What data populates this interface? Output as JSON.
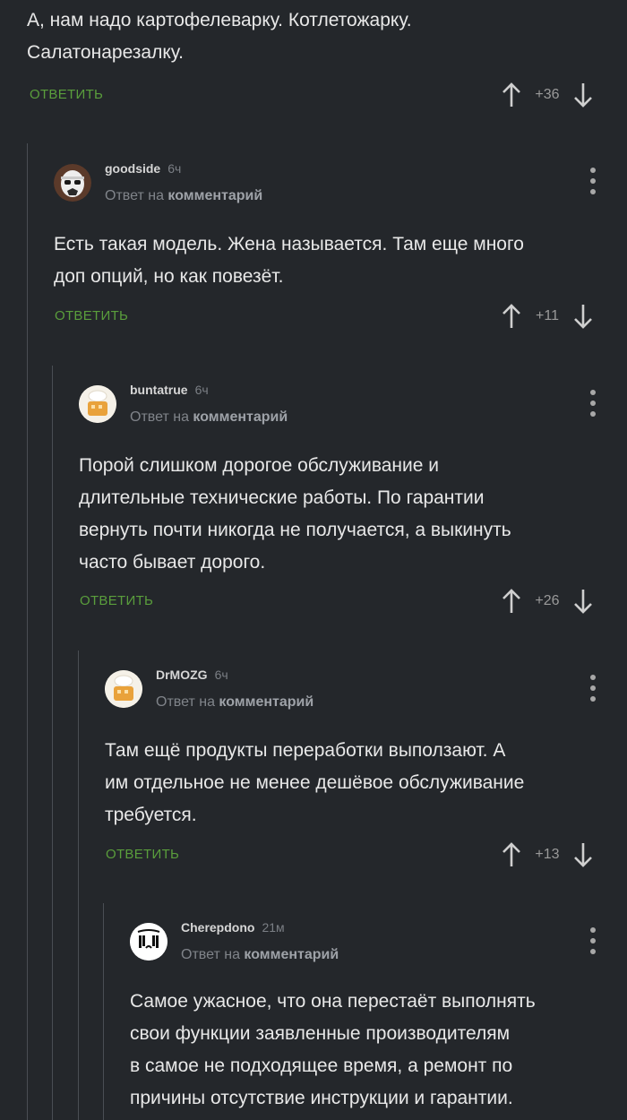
{
  "top_comment": {
    "text_line1": "А, нам надо картофелеварку. Котлетожарку.",
    "text_line2": "Салатонарезалку.",
    "reply_label": "ОТВЕТИТЬ",
    "score": "+36"
  },
  "comments": [
    {
      "author": "goodside",
      "time": "6ч",
      "reply_to_prefix": "Ответ на",
      "reply_to_target": "комментарий",
      "lines": [
        "Есть такая модель. Жена называется. Там еще много",
        "доп опций, но как повезёт."
      ],
      "reply_label": "ОТВЕТИТЬ",
      "score": "+11",
      "avatar_icon": "stormtrooper-avatar-icon"
    },
    {
      "author": "buntatrue",
      "time": "6ч",
      "reply_to_prefix": "Ответ на",
      "reply_to_target": "комментарий",
      "lines": [
        "Порой слишком дорогое обслуживание и",
        "длительные технические работы. По гарантии",
        "вернуть почти никогда не получается, а выкинуть",
        "часто бывает дорого."
      ],
      "reply_label": "ОТВЕТИТЬ",
      "score": "+26",
      "avatar_icon": "chef-avatar-icon"
    },
    {
      "author": "DrMOZG",
      "time": "6ч",
      "reply_to_prefix": "Ответ на",
      "reply_to_target": "комментарий",
      "lines": [
        "Там ещё продукты переработки выползают. А",
        "им отдельное не менее дешёвое обслуживание",
        "требуется."
      ],
      "reply_label": "ОТВЕТИТЬ",
      "score": "+13",
      "avatar_icon": "chef-avatar-icon"
    },
    {
      "author": "Cherepdono",
      "time": "21м",
      "reply_to_prefix": "Ответ на",
      "reply_to_target": "комментарий",
      "lines": [
        "Самое ужасное, что она перестаёт выполнять",
        "свои функции заявленные производителям",
        "в самое не подходящее время, а ремонт по",
        "причины отсутствие инструкции и гарантии."
      ],
      "avatar_icon": "crying-face-avatar-icon"
    }
  ],
  "colors": {
    "background": "#24272b",
    "reply_green": "#5a9e3c",
    "thread_line": "#4a4e54"
  }
}
